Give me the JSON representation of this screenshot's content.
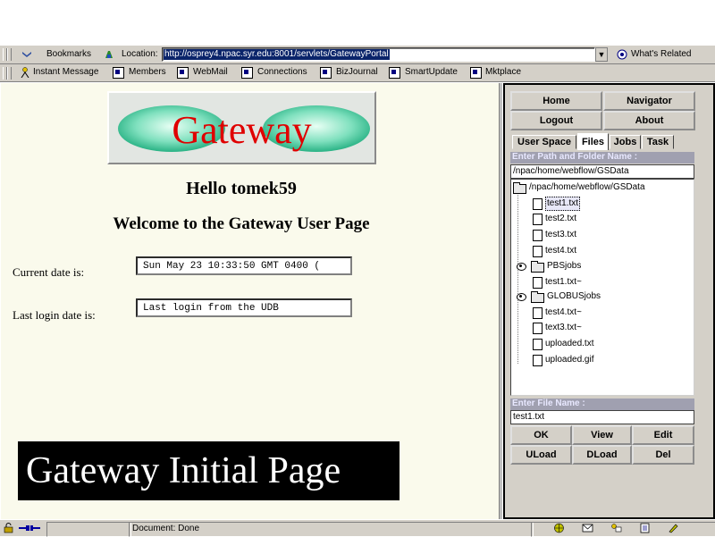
{
  "browser": {
    "nav_bar": {
      "bookmarks_label": "Bookmarks",
      "location_label": "Location:",
      "url": "http://osprey4.npac.syr.edu:8001/servlets/GatewayPortal",
      "whats_related_label": "What's Related"
    },
    "personal_bar": [
      {
        "label": "Instant Message"
      },
      {
        "label": "Members"
      },
      {
        "label": "WebMail"
      },
      {
        "label": "Connections"
      },
      {
        "label": "BizJournal"
      },
      {
        "label": "SmartUpdate"
      },
      {
        "label": "Mktplace"
      }
    ],
    "status": "Document: Done"
  },
  "page": {
    "logo_text": "Gateway",
    "greeting": "Hello tomek59",
    "welcome": "Welcome to the Gateway User Page",
    "current_date_label": "Current date is:",
    "current_date_value": "Sun May 23 10:33:50 GMT 0400 (",
    "last_login_label": "Last login date is:",
    "last_login_value": "Last login from the UDB",
    "banner": "Gateway Initial Page"
  },
  "sidebar": {
    "buttons": {
      "home": "Home",
      "navigator": "Navigator",
      "logout": "Logout",
      "about": "About"
    },
    "tabs": [
      "User Space",
      "Files",
      "Jobs",
      "Task"
    ],
    "active_tab": "Files",
    "path_label": "Enter Path and Folder Name :",
    "path_value": "/npac/home/webflow/GSData",
    "tree": {
      "root": "/npac/home/webflow/GSData",
      "items": [
        {
          "name": "test1.txt",
          "type": "file",
          "selected": true
        },
        {
          "name": "test2.txt",
          "type": "file"
        },
        {
          "name": "test3.txt",
          "type": "file"
        },
        {
          "name": "test4.txt",
          "type": "file"
        },
        {
          "name": "PBSjobs",
          "type": "folder"
        },
        {
          "name": "test1.txt~",
          "type": "file"
        },
        {
          "name": "GLOBUSjobs",
          "type": "folder"
        },
        {
          "name": "test4.txt~",
          "type": "file"
        },
        {
          "name": "text3.txt~",
          "type": "file"
        },
        {
          "name": "uploaded.txt",
          "type": "file"
        },
        {
          "name": "uploaded.gif",
          "type": "file"
        }
      ]
    },
    "file_label": "Enter File Name :",
    "file_value": "test1.txt",
    "actions": {
      "ok": "OK",
      "view": "View",
      "edit": "Edit",
      "upload": "ULoad",
      "download": "DLoad",
      "delete": "Del"
    }
  },
  "colors": {
    "frame_bg": "#fafaec",
    "logo_red": "#e00000",
    "logo_green": "#2ec89a",
    "url_highlight": "#0a246a"
  }
}
